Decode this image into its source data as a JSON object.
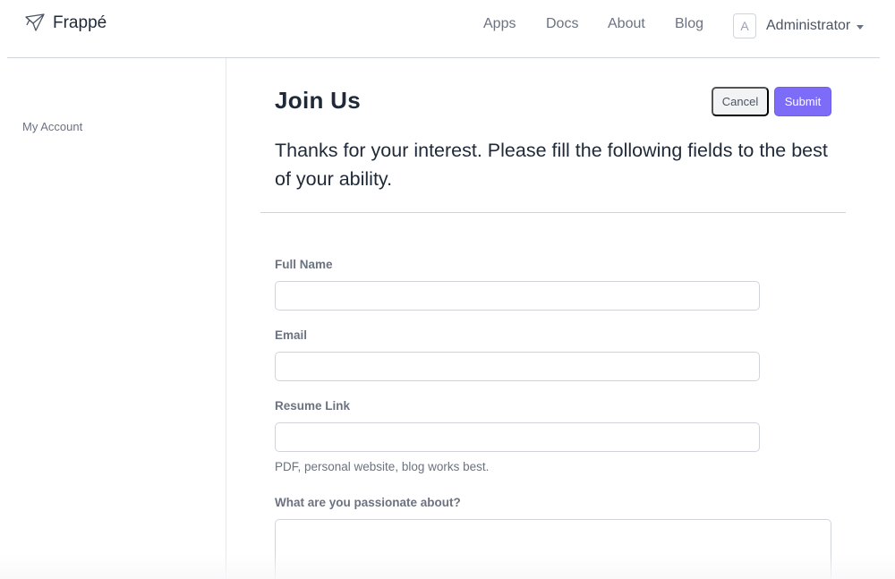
{
  "brand": {
    "name": "Frappé",
    "icon": "frappe-bird-icon"
  },
  "nav": {
    "links": [
      "Apps",
      "Docs",
      "About",
      "Blog"
    ],
    "user": {
      "avatar_letter": "A",
      "name": "Administrator"
    }
  },
  "sidebar": {
    "items": [
      {
        "label": "My Account"
      }
    ]
  },
  "page": {
    "title": "Join Us",
    "intro": "Thanks for your interest. Please fill the following fields to the best of your ability.",
    "buttons": {
      "cancel": "Cancel",
      "submit": "Submit"
    }
  },
  "form": {
    "fields": [
      {
        "label": "Full Name",
        "value": ""
      },
      {
        "label": "Email",
        "value": ""
      },
      {
        "label": "Resume Link",
        "value": "",
        "help": "PDF, personal website, blog works best."
      },
      {
        "label": "What are you passionate about?",
        "value": ""
      }
    ]
  },
  "colors": {
    "accent": "#7c6cf8"
  }
}
